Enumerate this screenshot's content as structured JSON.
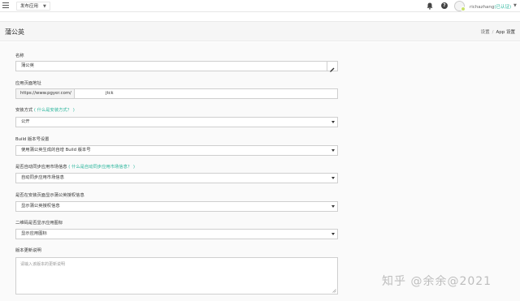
{
  "topbar": {
    "app_switch_label": "发布应用",
    "username": "richazhang",
    "user_badge": "(已认证)",
    "icons": [
      "menu-icon",
      "bell-icon",
      "help-icon",
      "avatar"
    ]
  },
  "header": {
    "title": "蒲公英",
    "breadcrumb": [
      "设置",
      "App 设置"
    ]
  },
  "form": {
    "name_label": "名称",
    "name_value": "蒲公英",
    "url_label": "应用页面地址",
    "url_prefix": "https://www.pgyer.com/",
    "url_value": "jtck",
    "install_label": "安装方式",
    "install_help": "( 什么是安装方式？ )",
    "install_value": "公开",
    "build_label": "Build 版本号设置",
    "build_value": "使用蒲公英生成的自增 Build 版本号",
    "sync_label": "是否自动同步应用市场信息",
    "sync_help": "( 什么是自动同步应用市场信息？ )",
    "sync_value": "自动同步应用市场信息",
    "auth_label": "是否在安装页面显示蒲公英授权信息",
    "auth_value": "显示蒲公英授权信息",
    "qr_label": "二维码是否显示应用图标",
    "qr_value": "显示应用图标",
    "changelog_label": "版本更新说明",
    "changelog_placeholder": "请输入该版本的更新说明"
  },
  "watermark": "知乎 @余余@2021"
}
